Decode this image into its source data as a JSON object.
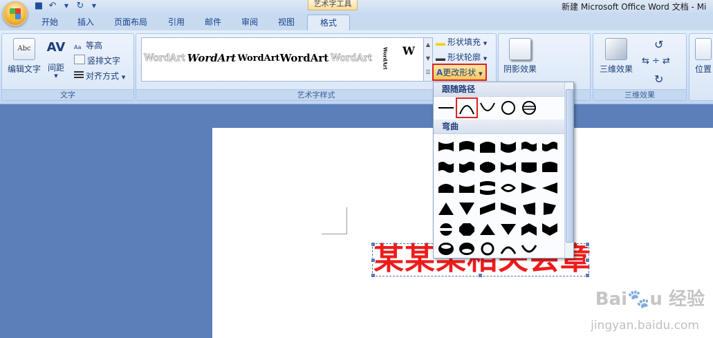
{
  "window": {
    "title": "新建 Microsoft Office Word 文档 - Mi",
    "context_tab_group": "艺术字工具"
  },
  "tabs": [
    "开始",
    "插入",
    "页面布局",
    "引用",
    "邮件",
    "审阅",
    "视图",
    "格式"
  ],
  "active_tab": "格式",
  "ribbon": {
    "text_group": {
      "label": "文字",
      "edit_text": "编辑文字",
      "spacing": "间距",
      "same_height": "等高",
      "vertical_text": "竖排文字",
      "align": "对齐方式"
    },
    "wordart_styles": {
      "label": "艺术字样式",
      "shape_fill": "形状填充",
      "shape_outline": "形状轮廓",
      "change_shape": "更改形状",
      "gallery": [
        "WordArt",
        "WordArt",
        "WordArt",
        "WordArt",
        "WordArt",
        "WordArt",
        "W"
      ]
    },
    "shadow": {
      "label": "阴影效果"
    },
    "three_d": {
      "btn": "三维效果",
      "label": "三维效果"
    },
    "position": {
      "label": "位置"
    }
  },
  "dropdown": {
    "follow_path_header": "跟随路径",
    "warp_header": "弯曲"
  },
  "document": {
    "wordart_text": "某某某相关会章"
  },
  "watermark": {
    "brand": "Bai",
    "brand2": "经验",
    "site": "jingyan.baidu.com"
  },
  "colors": {
    "accent_red": "#e02020",
    "wordart_red": "#ee1c1c"
  }
}
